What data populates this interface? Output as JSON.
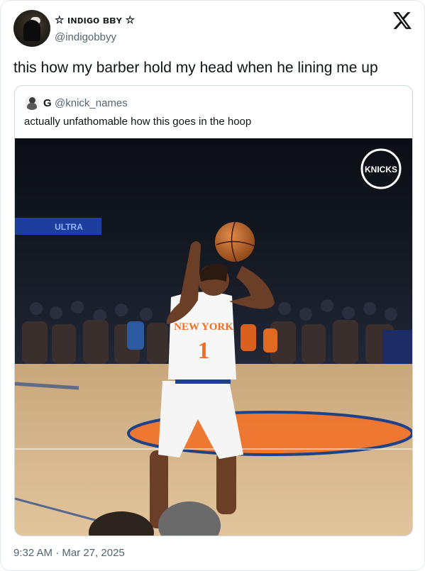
{
  "author": {
    "display_name": "☆ ιɴᴅιɢᴏ ʙʙʏ ☆",
    "handle": "@indigobbyy"
  },
  "tweet": {
    "text": "this how my barber hold my head when he lining me up",
    "timestamp": "9:32 AM · Mar 27, 2025"
  },
  "quoted_tweet": {
    "name": "G",
    "handle": "@knick_names",
    "text": "actually unfathomable how this goes in the hoop"
  },
  "photo": {
    "arena_banner": "ULTRA",
    "jersey_text": "NEW YORK",
    "jersey_number": "1",
    "logo_text": "KNICKS"
  },
  "icons": {
    "platform_logo": "x-logo-icon"
  },
  "colors": {
    "text_primary": "#0f1419",
    "text_secondary": "#536471",
    "border": "#cfd9de",
    "knicks_orange": "#f26d22",
    "knicks_blue": "#1d428a"
  }
}
